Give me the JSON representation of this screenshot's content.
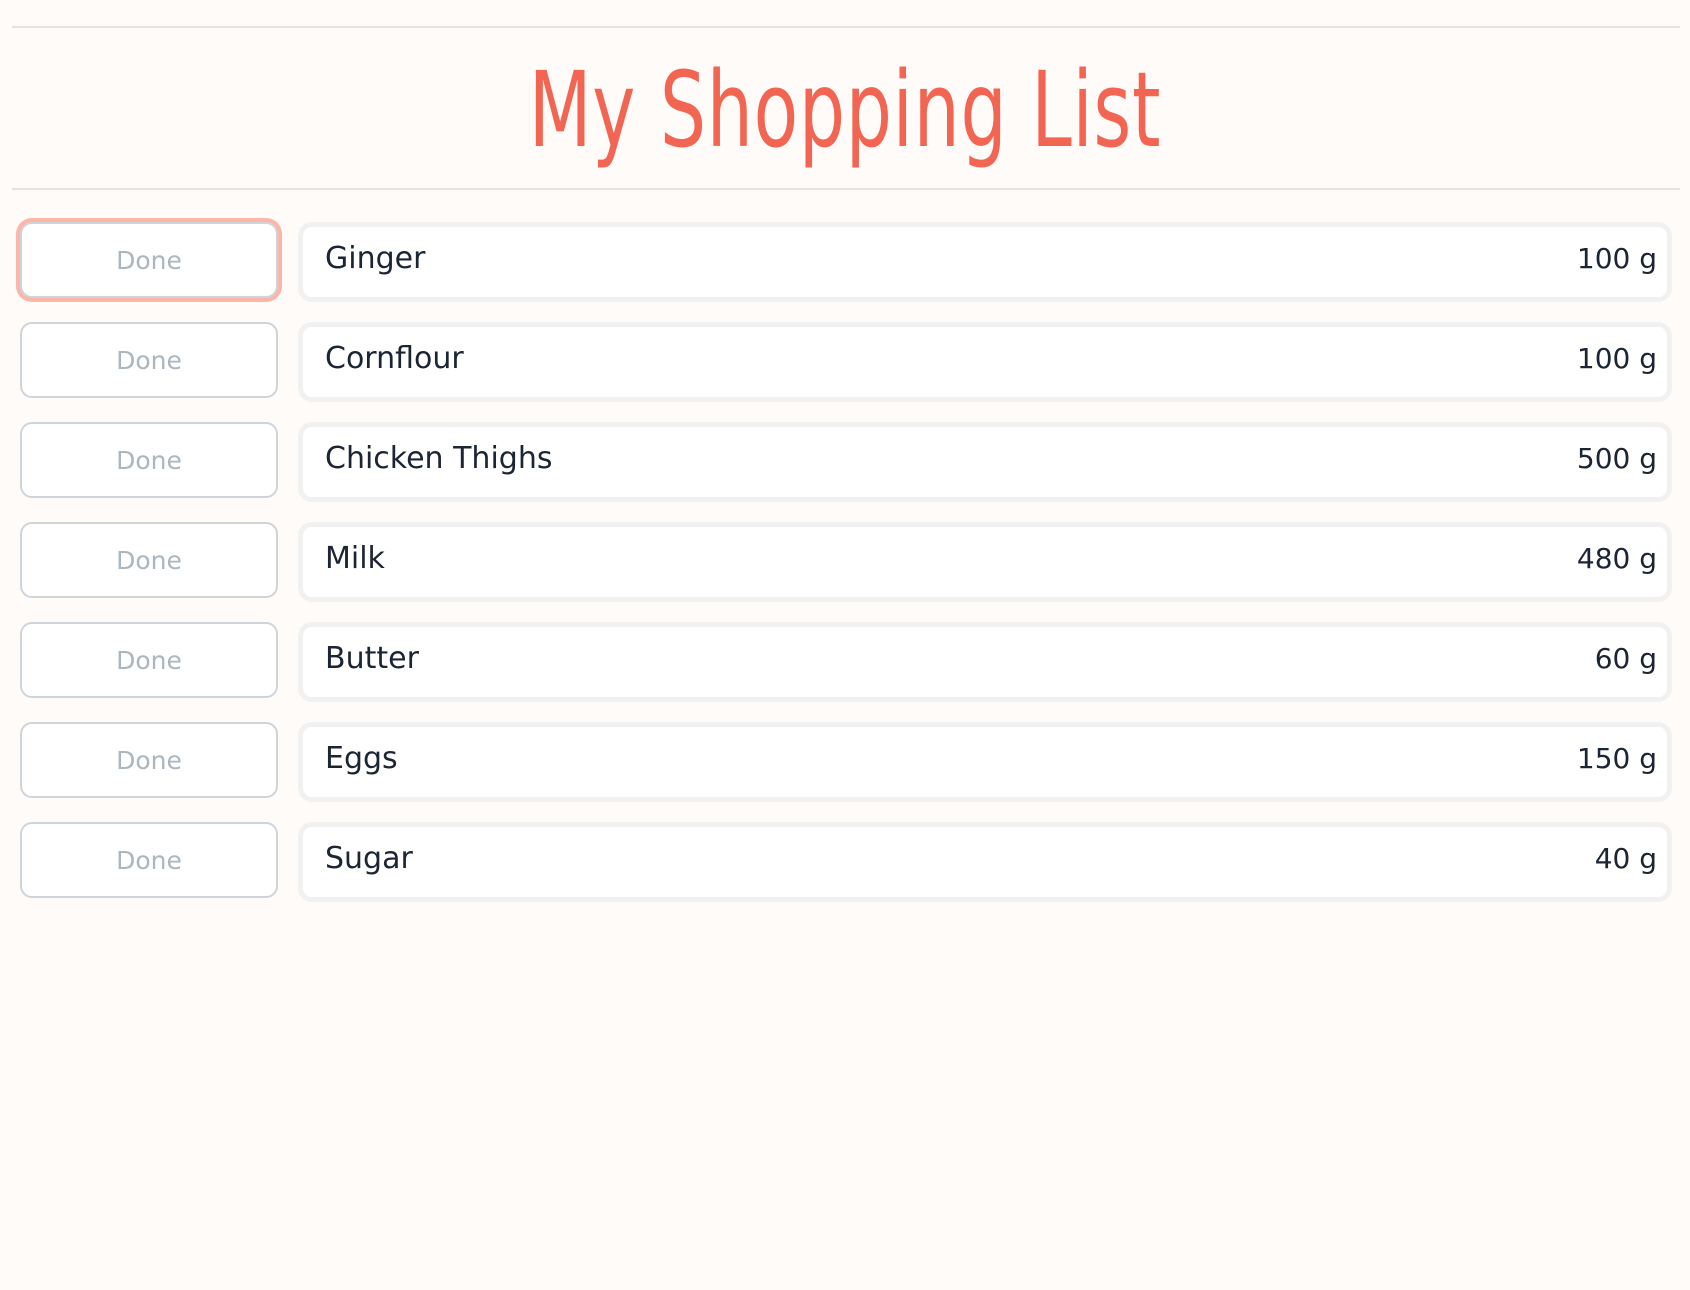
{
  "header": {
    "title": "My Shopping List"
  },
  "colors": {
    "background": "#fffbf8",
    "title": "#f26552",
    "focus_ring": "#fbb6a9",
    "done_text": "#aab6c0",
    "item_text": "#1b2533"
  },
  "items": [
    {
      "done_label": "Done",
      "name": "Ginger",
      "quantity": "100 g",
      "focused": true
    },
    {
      "done_label": "Done",
      "name": "Cornflour",
      "quantity": "100 g",
      "focused": false
    },
    {
      "done_label": "Done",
      "name": "Chicken Thighs",
      "quantity": "500 g",
      "focused": false
    },
    {
      "done_label": "Done",
      "name": "Milk",
      "quantity": "480 g",
      "focused": false
    },
    {
      "done_label": "Done",
      "name": "Butter",
      "quantity": "60 g",
      "focused": false
    },
    {
      "done_label": "Done",
      "name": "Eggs",
      "quantity": "150 g",
      "focused": false
    },
    {
      "done_label": "Done",
      "name": "Sugar",
      "quantity": "40 g",
      "focused": false
    }
  ]
}
